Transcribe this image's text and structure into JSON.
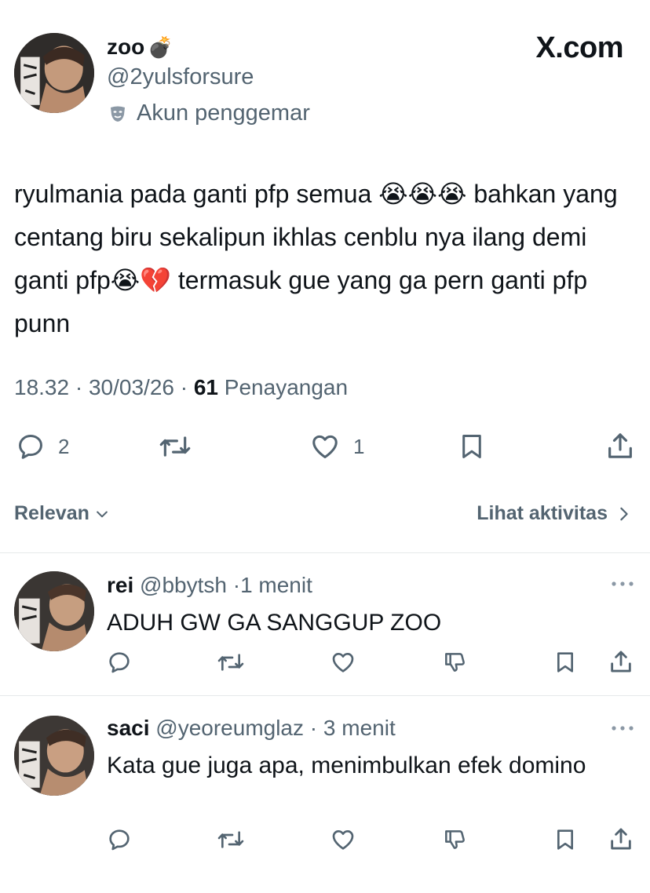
{
  "watermark": "X.com",
  "tweet": {
    "display_name": "zoo",
    "name_emoji": "💣",
    "handle": "@2yulsforsure",
    "label": "Akun penggemar",
    "label_icon": "theater-mask-icon",
    "text": "ryulmania pada ganti pfp semua 😭😭😭 bahkan yang centang biru sekalipun ikhlas cenblu nya ilang demi ganti pfp😭💔  termasuk gue yang ga pern ganti pfp punn",
    "time": "18.32",
    "date": "30/03/26",
    "views_count": "61",
    "views_label": "Penayangan",
    "replies": "2",
    "likes": "1"
  },
  "sort": {
    "label": "Relevan",
    "activity_label": "Lihat aktivitas"
  },
  "replies": [
    {
      "display_name": "rei",
      "handle": "@bbytsh",
      "time": "1 menit",
      "text": "ADUH GW GA SANGGUP ZOO"
    },
    {
      "display_name": "saci",
      "handle": "@yeoreumglaz",
      "time": "3 menit",
      "text": "Kata gue juga apa, menimbulkan efek domino"
    }
  ],
  "colors": {
    "text": "#0f1419",
    "muted": "#536471",
    "divider": "#e6e9ea"
  }
}
